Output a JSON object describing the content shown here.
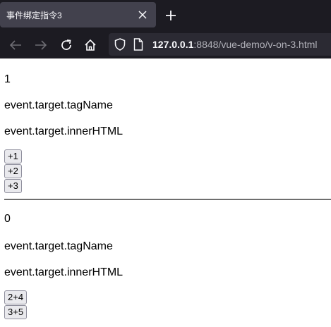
{
  "browser": {
    "tab_title": "事件绑定指令3",
    "url_host": "127.0.0.1",
    "url_rest": ":8848/vue-demo/v-on-3.html"
  },
  "section1": {
    "count": "1",
    "line1": "event.target.tagName",
    "line2": "event.target.innerHTML",
    "buttons": [
      "+1",
      "+2",
      "+3"
    ]
  },
  "section2": {
    "count": "0",
    "line1": "event.target.tagName",
    "line2": "event.target.innerHTML",
    "buttons": [
      "2+4",
      "3+5"
    ]
  }
}
